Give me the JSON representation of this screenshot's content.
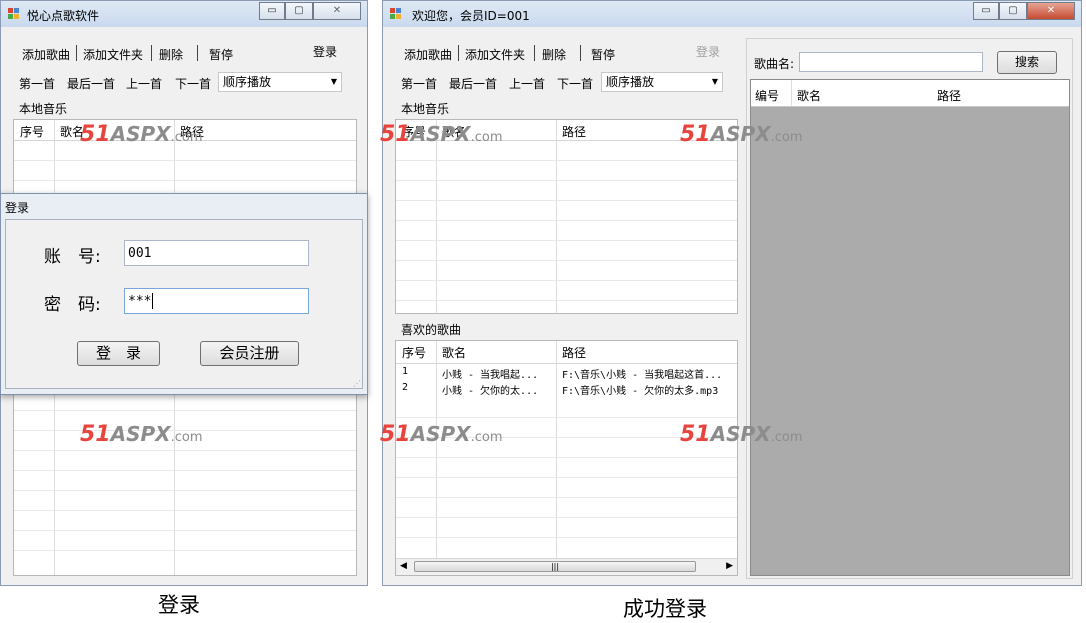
{
  "left_window": {
    "title": "悦心点歌软件",
    "controls": {
      "minimize": "▭",
      "maximize": "▢",
      "close": "✕"
    },
    "menu": {
      "add_song": "添加歌曲",
      "add_folder": "添加文件夹",
      "delete": "删除",
      "pause": "暂停",
      "login": "登录"
    },
    "nav": {
      "first": "第一首",
      "last": "最后一首",
      "prev": "上一首",
      "next": "下一首",
      "mode": "顺序播放"
    },
    "local_music_label": "本地音乐",
    "columns": [
      "序号",
      "歌名",
      "路径"
    ]
  },
  "login_dialog": {
    "title": "登录",
    "account_label": "账　号:",
    "account_value": "001",
    "password_label": "密　码:",
    "password_value": "***",
    "login_button": "登　录",
    "register_button": "会员注册"
  },
  "right_window": {
    "title": "欢迎您，会员ID=001",
    "controls": {
      "minimize": "▭",
      "maximize": "▢",
      "close": "✕"
    },
    "menu": {
      "add_song": "添加歌曲",
      "add_folder": "添加文件夹",
      "delete": "删除",
      "pause": "暂停",
      "login": "登录"
    },
    "nav": {
      "first": "第一首",
      "last": "最后一首",
      "prev": "上一首",
      "next": "下一首",
      "mode": "顺序播放"
    },
    "local_music_label": "本地音乐",
    "local_columns": [
      "序号",
      "歌名",
      "路径"
    ],
    "favorites_label": "喜欢的歌曲",
    "favorites_columns": [
      "序号",
      "歌名",
      "路径"
    ],
    "favorites_rows": [
      {
        "index": "1",
        "name": "小贱 - 当我唱起...",
        "path": "F:\\音乐\\小贱 - 当我唱起这首..."
      },
      {
        "index": "2",
        "name": "小贱 - 欠你的太...",
        "path": "F:\\音乐\\小贱 - 欠你的太多.mp3"
      }
    ],
    "search_label": "歌曲名:",
    "search_value": "",
    "search_button": "搜索",
    "result_columns": [
      "编号",
      "歌名",
      "路径"
    ]
  },
  "watermark": {
    "num": "51",
    "brand": "ASPX",
    "suffix": ".com"
  },
  "captions": {
    "left": "登录",
    "right": "成功登录"
  },
  "colors": {
    "titlebar": "#c9d9ee",
    "watermark_red": "#e6443c",
    "results_bg": "#ababab",
    "close_button": "#c44b32"
  }
}
